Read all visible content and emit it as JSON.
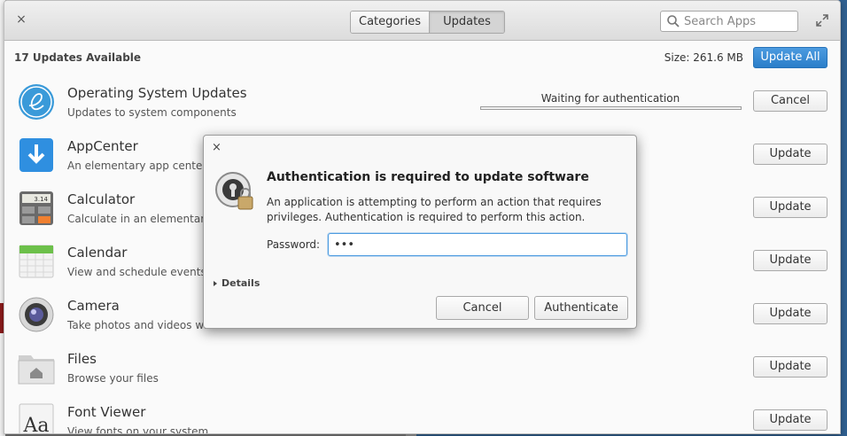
{
  "header": {
    "close_symbol": "×",
    "tabs": [
      {
        "label": "Categories",
        "active": false
      },
      {
        "label": "Updates",
        "active": true
      }
    ],
    "search_placeholder": "Search Apps"
  },
  "summary": {
    "count_label": "17 Updates Available",
    "size_label": "Size: 261.6 MB",
    "update_all_label": "Update All"
  },
  "updates": [
    {
      "title": "Operating System Updates",
      "description": "Updates to system components",
      "status": "Waiting for authentication",
      "action": "Cancel",
      "icon": "os-updates-icon",
      "progress": 0
    },
    {
      "title": "AppCenter",
      "description": "An elementary app center.",
      "action": "Update",
      "icon": "appcenter-icon"
    },
    {
      "title": "Calculator",
      "description": "Calculate in an elementary way",
      "action": "Update",
      "icon": "calculator-icon",
      "icon_text": "3.14"
    },
    {
      "title": "Calendar",
      "description": "View and schedule events",
      "action": "Update",
      "icon": "calendar-icon"
    },
    {
      "title": "Camera",
      "description": "Take photos and videos with the camera",
      "action": "Update",
      "icon": "camera-icon"
    },
    {
      "title": "Files",
      "description": "Browse your files",
      "action": "Update",
      "icon": "files-icon"
    },
    {
      "title": "Font Viewer",
      "description": "View fonts on your system",
      "action": "Update",
      "icon": "font-viewer-icon",
      "icon_text": "Aa"
    }
  ],
  "dialog": {
    "close_symbol": "×",
    "title": "Authentication is required to update software",
    "message": "An application is attempting to perform an action that requires privileges. Authentication is required to perform this action.",
    "password_label": "Password:",
    "password_value": "•••",
    "details_label": "Details",
    "cancel_label": "Cancel",
    "authenticate_label": "Authenticate"
  },
  "colors": {
    "accent": "#2a7ec9",
    "focus": "#4c9be0"
  }
}
